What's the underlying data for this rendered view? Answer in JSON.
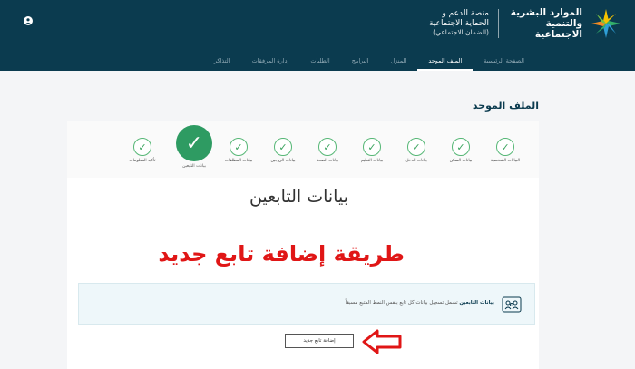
{
  "header": {
    "ministry_name": "الموارد البشرية والتنمية الاجتماعية",
    "platform_line1": "منصة الدعم و",
    "platform_line2": "الحماية الاجتماعية",
    "platform_line3": "(الضمان الاجتماعي)",
    "brand_colors": {
      "bar": "#0b3b4f",
      "accent": "#2e9b62"
    }
  },
  "nav": {
    "items": [
      {
        "label": "الصفحة الرئيسية",
        "active": false
      },
      {
        "label": "الملف الموحد",
        "active": true
      },
      {
        "label": "المنزل",
        "active": false
      },
      {
        "label": "البرامج",
        "active": false
      },
      {
        "label": "الطلبات",
        "active": false
      },
      {
        "label": "إدارة المرفقات",
        "active": false
      },
      {
        "label": "التذاكر",
        "active": false
      }
    ]
  },
  "page": {
    "title": "الملف الموحد"
  },
  "steps": [
    {
      "label": "البيانات الشخصية",
      "done": true,
      "current": false
    },
    {
      "label": "بيانات السكن",
      "done": true,
      "current": false
    },
    {
      "label": "بيانات الدخل",
      "done": true,
      "current": false
    },
    {
      "label": "بيانات التعليم",
      "done": true,
      "current": false
    },
    {
      "label": "بيانات الصحة",
      "done": true,
      "current": false
    },
    {
      "label": "بيانات الزوجين",
      "done": true,
      "current": false
    },
    {
      "label": "بيانات المطلقات",
      "done": true,
      "current": false
    },
    {
      "label": "بيانات التابعين",
      "done": true,
      "current": true
    },
    {
      "label": "تأكيد المعلومات",
      "done": true,
      "current": false
    }
  ],
  "section": {
    "title": "بيانات التابعين",
    "overlay_caption": "طريقة إضافة تابع جديد"
  },
  "info": {
    "bold": "بيانات التابعين",
    "text": "تشمل تسجيل بيانات كل تابع بنفس النمط المتبع مسبقاً"
  },
  "actions": {
    "add_label": "إضافة تابع جديد"
  }
}
